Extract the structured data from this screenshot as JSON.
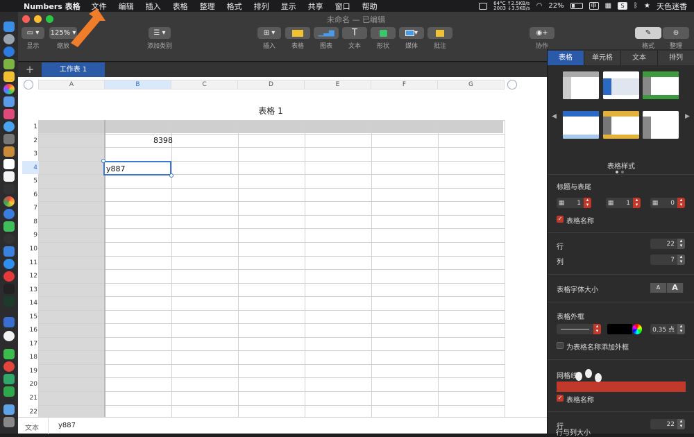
{
  "menubar": {
    "app_name": "Numbers 表格",
    "menus": [
      "文件",
      "编辑",
      "插入",
      "表格",
      "整理",
      "格式",
      "排列",
      "显示",
      "共享",
      "窗口",
      "帮助"
    ],
    "net_stats_line1": "64°C ↑2.5KB/s",
    "net_stats_line2": "2003 ↓3.5KB/s",
    "battery_percent": "22%",
    "input_method": "中",
    "app_tray_label": "S",
    "user_label": "天色迷香"
  },
  "window": {
    "title": "未命名",
    "title_status": "— 已编辑"
  },
  "toolbar": {
    "view_label": "显示",
    "zoom_value": "125%",
    "zoom_label": "缩放",
    "add_category_label": "添加类别",
    "insert_label": "插入",
    "table_label": "表格",
    "chart_label": "图表",
    "text_label": "文本",
    "shape_label": "形状",
    "media_label": "媒体",
    "comment_label": "批注",
    "collaborate_label": "协作",
    "format_label": "格式",
    "organize_label": "整理",
    "text_icon_glyph": "T"
  },
  "sheet": {
    "add_label": "+",
    "active_tab": "工作表 1",
    "table_title": "表格 1",
    "columns": [
      "A",
      "B",
      "C",
      "D",
      "E",
      "F",
      "G"
    ],
    "rows": [
      "1",
      "2",
      "3",
      "4",
      "5",
      "6",
      "7",
      "8",
      "9",
      "10",
      "11",
      "12",
      "13",
      "14",
      "15",
      "16",
      "17",
      "18",
      "19",
      "20",
      "21",
      "22"
    ],
    "cell_b2": "8398",
    "cell_b4": "y887"
  },
  "formula_bar": {
    "label": "文本",
    "value": "y887"
  },
  "inspector": {
    "tabs": [
      "表格",
      "单元格",
      "文本",
      "排列"
    ],
    "styles_caption": "表格样式",
    "headers_title": "标题与表尾",
    "header_rows": "1",
    "header_cols": "1",
    "footer_rows": "0",
    "table_name_checkbox": "表格名称",
    "rows_label": "行",
    "rows_value": "22",
    "cols_label": "列",
    "cols_value": "7",
    "font_size_label": "表格字体大小",
    "font_small": "A",
    "font_large": "A",
    "border_label": "表格外框",
    "border_width": "0.35 点",
    "add_border_checkbox": "为表格名称添加外框",
    "gridlines_label": "网格线",
    "gridlines_table_name": "表格名称",
    "rows_label_2": "行",
    "rows_value_2": "22",
    "row_col_size_label": "行与列大小"
  },
  "colors": {
    "accent_blue": "#2b5aa8",
    "selection_blue": "#3b78d4",
    "header_grey": "#cfcfcf",
    "checkbox_red": "#c0392b",
    "arrow_orange": "#f07d2a"
  }
}
